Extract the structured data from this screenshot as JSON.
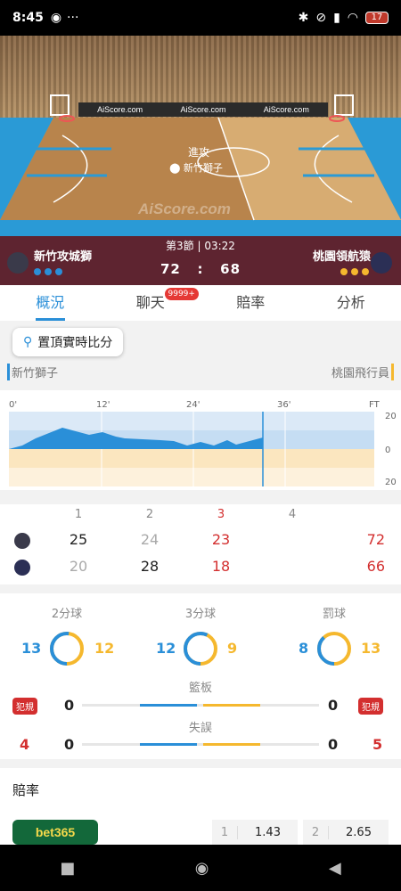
{
  "status": {
    "time": "8:45",
    "battery": "17"
  },
  "court": {
    "ads": [
      "AiScore.com",
      "AiScore.com",
      "AiScore.com"
    ],
    "attack_label": "進攻",
    "attack_team": "新竹獅子",
    "watermark": "AiScore.com"
  },
  "scoreboard": {
    "period": "第3節 | 03:22",
    "home_name": "新竹攻城獅",
    "away_name": "桃園領航猿",
    "home_score": "72",
    "sep": ":",
    "away_score": "68",
    "home_dot_color": "#2a8fd8",
    "away_dot_color": "#f5b82e"
  },
  "tabs": [
    {
      "label": "概況",
      "active": true
    },
    {
      "label": "聊天",
      "badge": "9999+"
    },
    {
      "label": "賠率"
    },
    {
      "label": "分析"
    }
  ],
  "pin_button": "置頂實時比分",
  "teams": {
    "left": "新竹獅子",
    "right": "桃園飛行員"
  },
  "momentum": {
    "x_labels": [
      "0'",
      "12'",
      "24'",
      "36'",
      "FT"
    ],
    "y_labels": [
      "20",
      "0",
      "20"
    ]
  },
  "quarters": {
    "headers": [
      "1",
      "2",
      "3",
      "4"
    ],
    "home": [
      "25",
      "24",
      "23",
      "",
      "72"
    ],
    "away": [
      "20",
      "28",
      "18",
      "",
      "66"
    ]
  },
  "stats": {
    "two_pt": {
      "label": "2分球",
      "home": "13",
      "away": "12"
    },
    "three_pt": {
      "label": "3分球",
      "home": "12",
      "away": "9"
    },
    "ft": {
      "label": "罰球",
      "home": "8",
      "away": "13"
    },
    "rebounds": {
      "label": "籃板",
      "home": "0",
      "away": "0"
    },
    "turnovers": {
      "label": "失誤",
      "home": "0",
      "away": "0"
    },
    "fouls_label": "犯規",
    "fouls_home": "4",
    "fouls_away": "5"
  },
  "odds": {
    "title": "賠率",
    "bookmaker": "bet365",
    "o1_label": "1",
    "o1_value": "1.43",
    "o2_label": "2",
    "o2_value": "2.65"
  },
  "colors": {
    "accent": "#2a8fd8",
    "away": "#f5b82e",
    "scoreboard": "#5e2430",
    "red": "#d32f2f"
  }
}
